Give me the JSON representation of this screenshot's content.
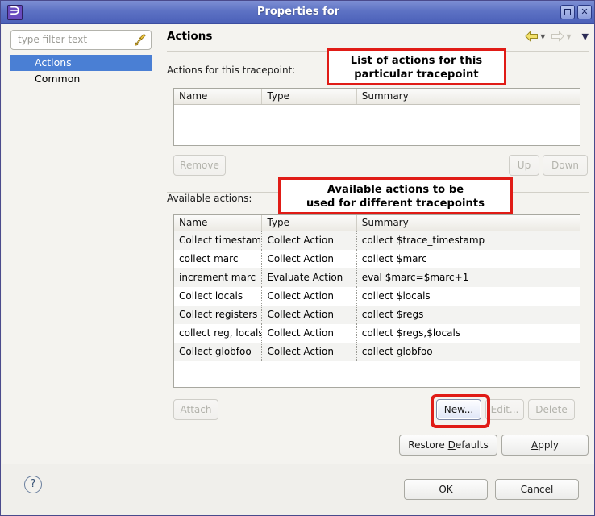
{
  "window": {
    "title": "Properties for",
    "app_icon": "eclipse-icon",
    "minimize_label": "",
    "maximize_label": "□",
    "close_label": "✕"
  },
  "sidebar": {
    "filter": {
      "placeholder": "type filter text",
      "value": "",
      "clear_icon": "broom-icon"
    },
    "items": [
      {
        "label": "Actions",
        "selected": true
      },
      {
        "label": "Common",
        "selected": false
      }
    ]
  },
  "content": {
    "page_title": "Actions",
    "nav": {
      "back_icon": "back-arrow-icon",
      "forward_icon": "forward-arrow-icon",
      "menu_icon": "view-menu-icon"
    },
    "tracepoint_actions": {
      "label": "Actions for this tracepoint:",
      "columns": [
        "Name",
        "Type",
        "Summary"
      ],
      "rows": []
    },
    "tracepoint_buttons": {
      "remove": "Remove",
      "up": "Up",
      "down": "Down"
    },
    "available_actions": {
      "label": "Available actions:",
      "columns": [
        "Name",
        "Type",
        "Summary"
      ],
      "rows": [
        {
          "name": "Collect timestam",
          "type": "Collect Action",
          "summary": "collect $trace_timestamp"
        },
        {
          "name": "collect marc",
          "type": "Collect Action",
          "summary": "collect $marc"
        },
        {
          "name": "increment marc",
          "type": "Evaluate Action",
          "summary": "eval $marc=$marc+1"
        },
        {
          "name": "Collect locals",
          "type": "Collect Action",
          "summary": "collect $locals"
        },
        {
          "name": "Collect registers",
          "type": "Collect Action",
          "summary": "collect $regs"
        },
        {
          "name": "collect reg, locals",
          "type": "Collect Action",
          "summary": "collect $regs,$locals"
        },
        {
          "name": "Collect globfoo",
          "type": "Collect Action",
          "summary": "collect globfoo"
        }
      ]
    },
    "available_buttons": {
      "attach": "Attach",
      "new": "New...",
      "edit": "Edit...",
      "delete": "Delete"
    },
    "bottom_buttons": {
      "restore_defaults_pre": "Restore ",
      "restore_defaults_mnemonic": "D",
      "restore_defaults_post": "efaults",
      "apply_pre": "",
      "apply_mnemonic": "A",
      "apply_post": "pply"
    }
  },
  "annotations": {
    "top": {
      "line1": "List of actions for this",
      "line2": "particular tracepoint"
    },
    "bottom": {
      "line1": "Available actions to be",
      "line2": "used for different tracepoints"
    },
    "highlight_color": "#e01b16"
  },
  "footer": {
    "help_icon": "help-question-icon",
    "ok": "OK",
    "cancel": "Cancel"
  }
}
